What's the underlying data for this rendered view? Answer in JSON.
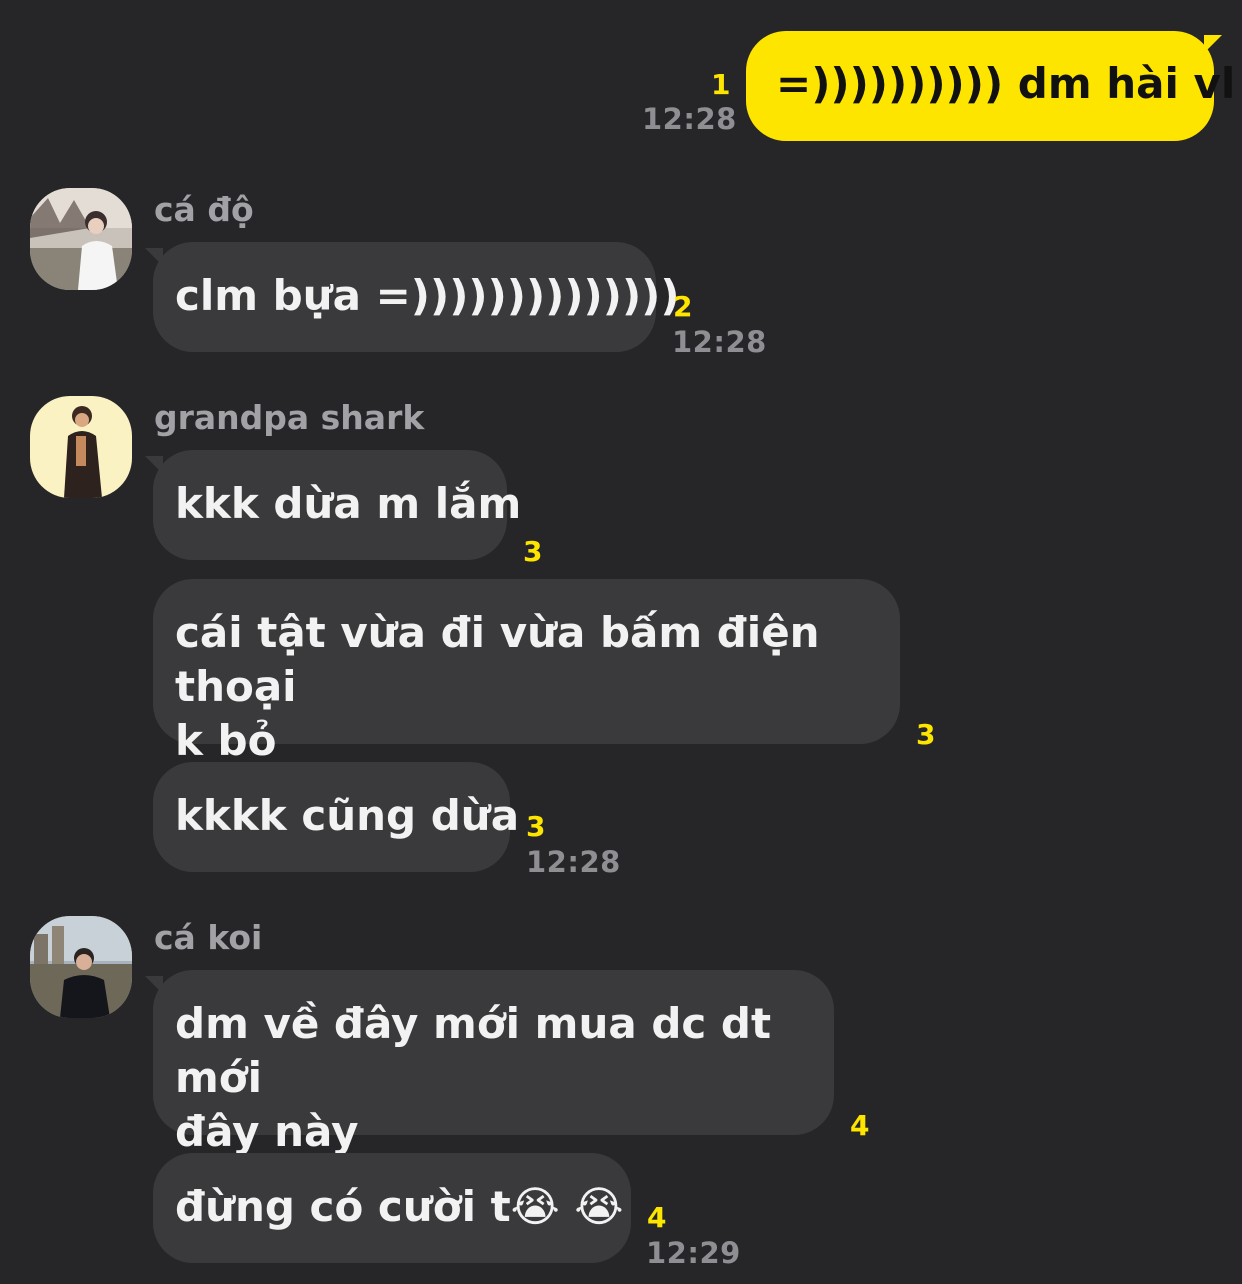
{
  "colors": {
    "background": "#262628",
    "incoming_bubble": "#3a3a3c",
    "outgoing_bubble": "#fee500",
    "unread_count": "#fee500",
    "timestamp": "#8e8e93"
  },
  "messages": {
    "m1": {
      "text": "=)))))))))) dm hài vl",
      "unread": "1",
      "time": "12:28"
    },
    "g1": {
      "sender": "cá độ",
      "avatar_icon": "avatar-photo-person-white-shirt",
      "m1": {
        "text": "clm bựa =))))))))))))))",
        "unread": "2",
        "time": "12:28"
      }
    },
    "g2": {
      "sender": "grandpa shark",
      "avatar_icon": "avatar-photo-person-dark-jacket",
      "m1": {
        "text": "kkk dừa m lắm",
        "unread": "3"
      },
      "m2": {
        "line1": "cái tật vừa đi vừa bấm điện thoại",
        "line2": "k bỏ",
        "unread": "3"
      },
      "m3": {
        "text": "kkkk cũng dừa",
        "unread": "3",
        "time": "12:28"
      }
    },
    "g3": {
      "sender": "cá koi",
      "avatar_icon": "avatar-photo-person-outdoor",
      "m1": {
        "line1": "dm về đây mới mua dc dt mới",
        "line2": "đây này",
        "unread": "4"
      },
      "m2": {
        "text": "đừng có cười t",
        "emoji": "😭 😭",
        "unread": "4",
        "time": "12:29"
      }
    }
  }
}
